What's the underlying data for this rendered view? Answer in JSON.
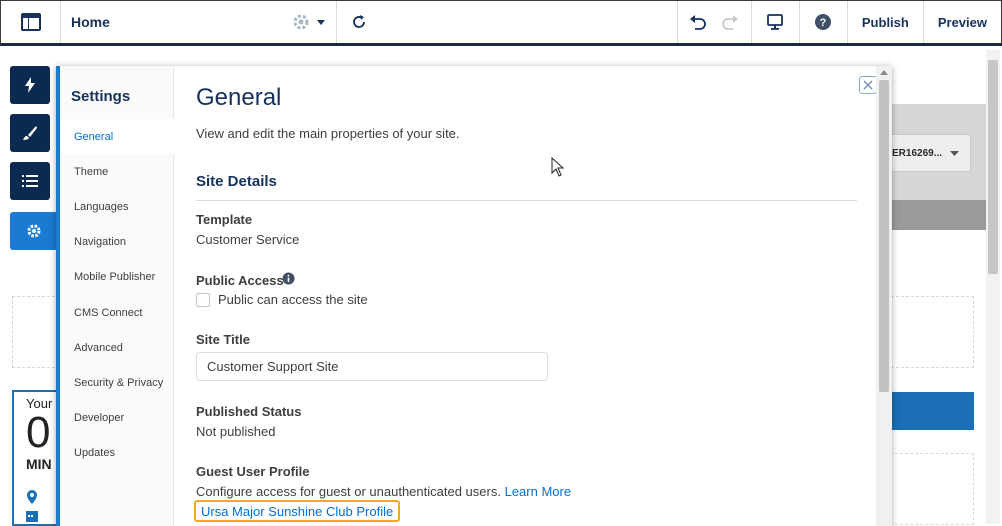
{
  "header": {
    "page_name": "Home",
    "publish_label": "Publish",
    "preview_label": "Preview"
  },
  "background": {
    "dropdown_text": "ER16269...",
    "card_your": "Your",
    "card_zero": "0",
    "card_min": "MIN"
  },
  "settings": {
    "nav_title": "Settings",
    "nav_items": [
      {
        "label": "General",
        "active": true
      },
      {
        "label": "Theme"
      },
      {
        "label": "Languages"
      },
      {
        "label": "Navigation"
      },
      {
        "label": "Mobile Publisher"
      },
      {
        "label": "CMS Connect"
      },
      {
        "label": "Advanced"
      },
      {
        "label": "Security & Privacy"
      },
      {
        "label": "Developer"
      },
      {
        "label": "Updates"
      }
    ],
    "title": "General",
    "subtitle": "View and edit the main properties of your site.",
    "section_title": "Site Details",
    "template_label": "Template",
    "template_value": "Customer Service",
    "public_access_label": "Public Access",
    "public_access_checkbox": "Public can access the site",
    "site_title_label": "Site Title",
    "site_title_value": "Customer Support Site",
    "published_status_label": "Published Status",
    "published_status_value": "Not published",
    "guest_profile_label": "Guest User Profile",
    "guest_profile_desc": "Configure access for guest or unauthenticated users.",
    "learn_more": "Learn More",
    "guest_profile_link": "Ursa Major Sunshine Club Profile"
  },
  "colors": {
    "brand_blue": "#1b7ad1",
    "nav_dark": "#0b2a4f",
    "link": "#0070d2",
    "highlight": "#f5a623"
  }
}
